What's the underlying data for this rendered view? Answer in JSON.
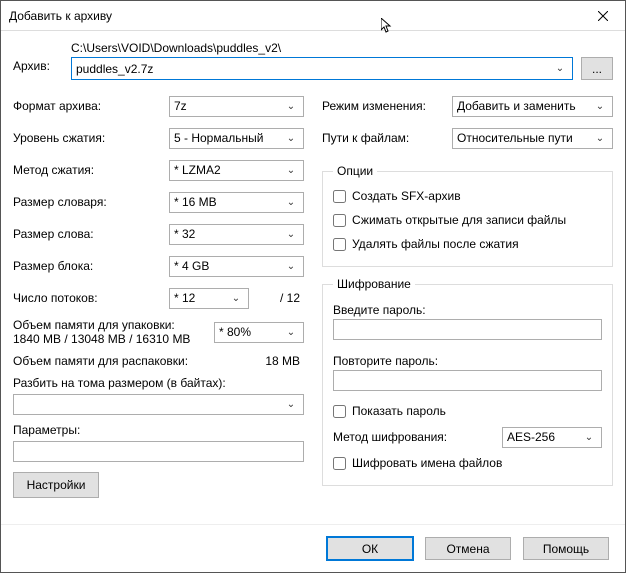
{
  "title": "Добавить к архиву",
  "archive": {
    "label": "Архив:",
    "path": "C:\\Users\\VOID\\Downloads\\puddles_v2\\",
    "filename": "puddles_v2.7z",
    "browse": "..."
  },
  "left": {
    "format_label": "Формат архива:",
    "format_value": "7z",
    "level_label": "Уровень сжатия:",
    "level_value": "5 - Нормальный",
    "method_label": "Метод сжатия:",
    "method_value": "* LZMA2",
    "dict_label": "Размер словаря:",
    "dict_value": "* 16 MB",
    "word_label": "Размер слова:",
    "word_value": "* 32",
    "block_label": "Размер блока:",
    "block_value": "* 4 GB",
    "threads_label": "Число потоков:",
    "threads_value": "* 12",
    "threads_max": "/ 12",
    "mem_pack_label": "Объем памяти для упаковки:",
    "mem_pack_value": "1840 MB / 13048 MB / 16310 MB",
    "mem_pack_pct": "* 80%",
    "mem_unpack_label": "Объем памяти для распаковки:",
    "mem_unpack_value": "18 MB",
    "split_label": "Разбить на тома размером (в байтах):",
    "params_label": "Параметры:",
    "settings_btn": "Настройки"
  },
  "right": {
    "update_label": "Режим изменения:",
    "update_value": "Добавить и заменить",
    "paths_label": "Пути к файлам:",
    "paths_value": "Относительные пути",
    "options_legend": "Опции",
    "opt_sfx": "Создать SFX-архив",
    "opt_shared": "Сжимать открытые для записи файлы",
    "opt_delete": "Удалять файлы после сжатия",
    "enc_legend": "Шифрование",
    "pw_label": "Введите пароль:",
    "pw2_label": "Повторите пароль:",
    "show_pw": "Показать пароль",
    "enc_method_label": "Метод шифрования:",
    "enc_method_value": "AES-256",
    "enc_names": "Шифровать имена файлов"
  },
  "footer": {
    "ok": "ОК",
    "cancel": "Отмена",
    "help": "Помощь"
  }
}
